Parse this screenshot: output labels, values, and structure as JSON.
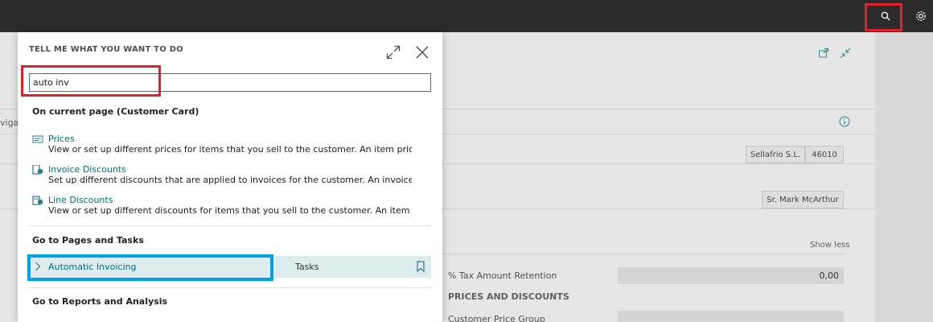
{
  "topbar": {
    "search_icon": "search-icon",
    "settings_icon": "gear-icon"
  },
  "background": {
    "nav_fragment": "viga",
    "company_field": "Sellafrio S.L.",
    "company_code": "46010",
    "contact_field": "Sr. Mark McArthur",
    "show_less": "Show less",
    "tax_label": "% Tax Amount Retention",
    "tax_value": "0,00",
    "prices_section": "PRICES AND DISCOUNTS",
    "price_group_label": "Customer Price Group"
  },
  "dialog": {
    "title": "TELL ME WHAT YOU WANT TO DO",
    "search_value": "auto inv",
    "current_page_heading": "On current page (Customer Card)",
    "results": [
      {
        "title": "Prices",
        "description": "View or set up different prices for items that you sell to the customer. An item price is ...",
        "icon": "price-list-icon"
      },
      {
        "title": "Invoice Discounts",
        "description": "Set up different discounts that are applied to invoices for the customer. An invoice dis...",
        "icon": "invoice-discount-icon"
      },
      {
        "title": "Line Discounts",
        "description": "View or set up different discounts for items that you sell to the customer. An item disc...",
        "icon": "line-discount-icon"
      }
    ],
    "pages_heading": "Go to Pages and Tasks",
    "task": {
      "label": "Automatic Invoicing",
      "category": "Tasks"
    },
    "reports_heading": "Go to Reports and Analysis"
  },
  "colors": {
    "accent": "#00707a",
    "highlight_red": "#e32126",
    "highlight_blue": "#00a2e8",
    "topbar": "#2b2b2b"
  }
}
